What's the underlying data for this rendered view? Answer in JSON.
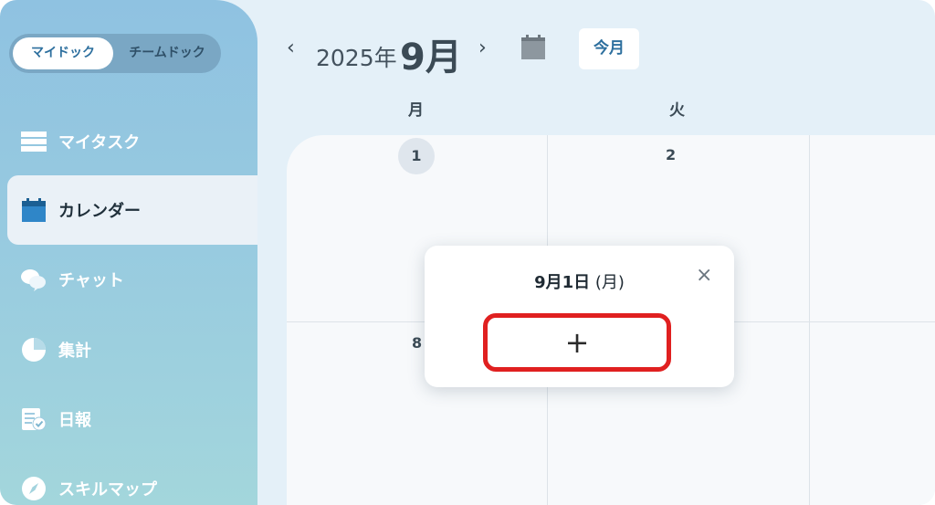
{
  "sidebar": {
    "toggle": {
      "active": "マイドック",
      "inactive": "チームドック"
    },
    "items": [
      {
        "label": "マイタスク",
        "icon": "list-icon"
      },
      {
        "label": "カレンダー",
        "icon": "calendar-icon"
      },
      {
        "label": "チャット",
        "icon": "chat-icon"
      },
      {
        "label": "集計",
        "icon": "pie-chart-icon"
      },
      {
        "label": "日報",
        "icon": "report-icon"
      },
      {
        "label": "スキルマップ",
        "icon": "compass-icon"
      }
    ]
  },
  "header": {
    "prev": "‹",
    "next": "›",
    "year": "2025年",
    "month": "9月",
    "today_button": "今月"
  },
  "weekdays": [
    "月",
    "火"
  ],
  "days": [
    "1",
    "2",
    "8"
  ],
  "popup": {
    "date": "9月1日",
    "weekday": "(月)",
    "close": "×",
    "add": "+"
  },
  "colors": {
    "accent": "#2d6f9e",
    "highlight": "#e02020",
    "sidebar": "#97cae0"
  }
}
